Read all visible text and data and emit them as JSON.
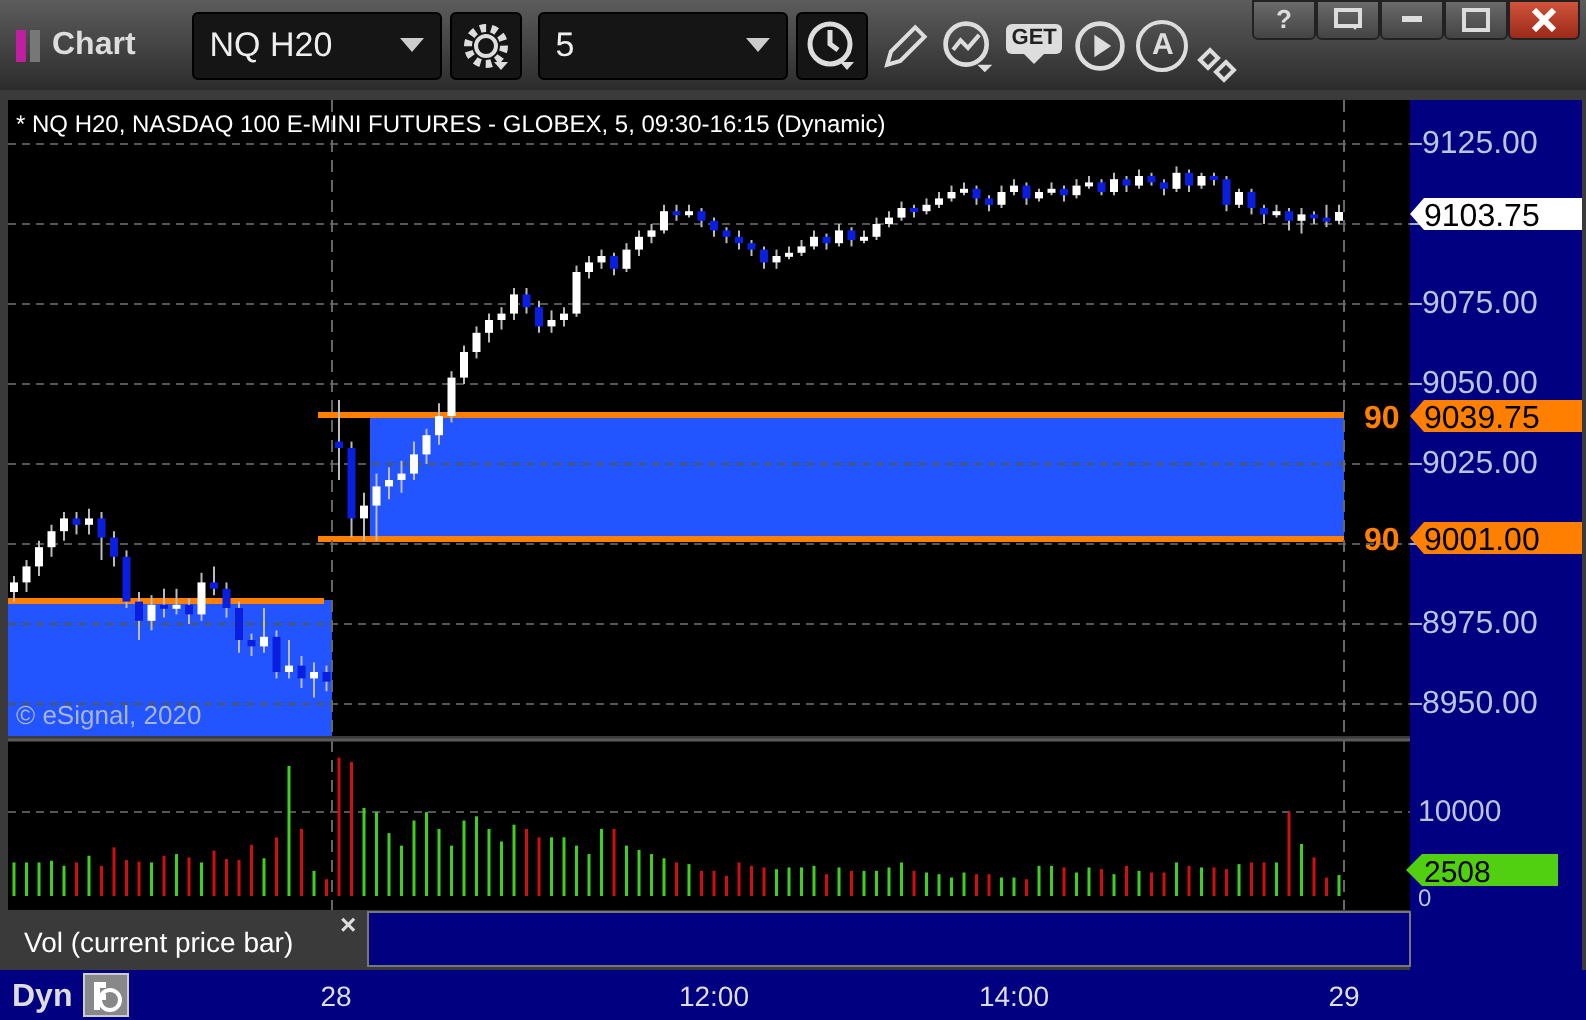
{
  "toolbar": {
    "app_title": "Chart",
    "symbol": "NQ H20",
    "interval": "5",
    "get_button": "GET",
    "letter_button": "A"
  },
  "window_buttons": {
    "help": "?"
  },
  "chart": {
    "title": "* NQ H20, NASDAQ 100 E-MINI FUTURES - GLOBEX, 5, 09:30-16:15 (Dynamic)",
    "copyright": "© eSignal, 2020",
    "price_tags": [
      {
        "text": "9103.75",
        "kind": "last"
      },
      {
        "text": "9039.75",
        "kind": "level"
      },
      {
        "text": "9001.00",
        "kind": "level"
      }
    ],
    "level_labels": [
      "90",
      "90"
    ],
    "chart_data": {
      "type": "candlestick",
      "ylim": [
        8940,
        9138.75
      ],
      "yticks": [
        {
          "value": 9125,
          "label": "9125.00"
        },
        {
          "value": 9075,
          "label": "9075.00"
        },
        {
          "value": 9050,
          "label": "9050.00"
        },
        {
          "value": 9025,
          "label": "9025.00"
        },
        {
          "value": 8975,
          "label": "8975.00"
        },
        {
          "value": 8950,
          "label": "8950.00"
        }
      ],
      "categories": [
        null,
        null,
        null,
        null,
        null,
        null,
        null,
        null,
        null,
        null,
        null,
        null,
        null,
        null,
        null,
        null,
        null,
        null,
        null,
        null,
        null,
        null,
        null,
        null,
        null,
        null,
        null,
        null,
        null,
        null,
        null,
        null,
        null,
        null,
        null,
        null,
        null,
        null,
        null,
        null,
        null,
        null,
        null,
        null,
        null,
        null,
        null,
        null,
        null,
        null,
        null,
        null,
        null,
        null,
        null,
        null,
        null,
        null,
        null,
        null,
        null,
        null,
        null,
        null,
        null,
        null,
        null,
        null,
        null,
        null,
        null,
        null,
        null,
        null,
        null,
        null,
        null,
        null,
        null,
        null,
        null,
        null,
        null,
        null,
        null,
        null,
        null,
        null,
        null,
        null,
        null,
        null,
        null,
        null,
        null,
        null,
        null,
        null,
        null,
        null,
        null,
        null,
        null,
        null,
        null,
        null,
        null
      ],
      "ohlc": [
        [
          8985,
          8990,
          8982,
          8988
        ],
        [
          8988,
          8995,
          8985,
          8993
        ],
        [
          8993,
          9001,
          8990,
          8999
        ],
        [
          8999,
          9006,
          8996,
          9004
        ],
        [
          9004,
          9010,
          9001,
          9008
        ],
        [
          9008,
          9010,
          9003,
          9006
        ],
        [
          9006,
          9011,
          9003,
          9008
        ],
        [
          9008,
          9010,
          8995,
          9002
        ],
        [
          9002,
          9004,
          8993,
          8996
        ],
        [
          8996,
          8998,
          8980,
          8982
        ],
        [
          8982,
          8985,
          8970,
          8976
        ],
        [
          8976,
          8984,
          8973,
          8981
        ],
        [
          8981,
          8986,
          8977,
          8980
        ],
        [
          8980,
          8986,
          8978,
          8981
        ],
        [
          8981,
          8983,
          8975,
          8978
        ],
        [
          8978,
          8991,
          8976,
          8988
        ],
        [
          8988,
          8993,
          8984,
          8986
        ],
        [
          8986,
          8988,
          8977,
          8980
        ],
        [
          8980,
          8982,
          8966,
          8970
        ],
        [
          8970,
          8972,
          8965,
          8968
        ],
        [
          8968,
          8980,
          8966,
          8971
        ],
        [
          8971,
          8973,
          8958,
          8960
        ],
        [
          8960,
          8970,
          8958,
          8962
        ],
        [
          8962,
          8965,
          8955,
          8958
        ],
        [
          8958,
          8963,
          8952,
          8960
        ],
        [
          8960,
          8962,
          8954,
          8957
        ],
        [
          9032,
          9045,
          9020,
          9030
        ],
        [
          9030,
          9032,
          9002,
          9008
        ],
        [
          9008,
          9016,
          9001,
          9012
        ],
        [
          9012,
          9022,
          9001,
          9018
        ],
        [
          9018,
          9024,
          9014,
          9020
        ],
        [
          9020,
          9026,
          9016,
          9022
        ],
        [
          9022,
          9032,
          9020,
          9028
        ],
        [
          9028,
          9036,
          9025,
          9034
        ],
        [
          9034,
          9044,
          9031,
          9040
        ],
        [
          9040,
          9054,
          9038,
          9052
        ],
        [
          9052,
          9062,
          9050,
          9060
        ],
        [
          9060,
          9068,
          9058,
          9066
        ],
        [
          9066,
          9072,
          9063,
          9070
        ],
        [
          9070,
          9074,
          9067,
          9072
        ],
        [
          9072,
          9080,
          9070,
          9078
        ],
        [
          9078,
          9080,
          9072,
          9074
        ],
        [
          9074,
          9076,
          9066,
          9068
        ],
        [
          9068,
          9073,
          9066,
          9070
        ],
        [
          9070,
          9074,
          9068,
          9072
        ],
        [
          9072,
          9087,
          9071,
          9085
        ],
        [
          9085,
          9090,
          9083,
          9088
        ],
        [
          9088,
          9092,
          9086,
          9090
        ],
        [
          9090,
          9091,
          9084,
          9086
        ],
        [
          9086,
          9094,
          9085,
          9092
        ],
        [
          9092,
          9098,
          9090,
          9096
        ],
        [
          9096,
          9100,
          9094,
          9098
        ],
        [
          9098,
          9106,
          9097,
          9104
        ],
        [
          9104,
          9106,
          9101,
          9103
        ],
        [
          9103,
          9106,
          9102,
          9104
        ],
        [
          9104,
          9105,
          9099,
          9101
        ],
        [
          9101,
          9102,
          9096,
          9098
        ],
        [
          9098,
          9099,
          9094,
          9096
        ],
        [
          9096,
          9098,
          9092,
          9094
        ],
        [
          9094,
          9095,
          9090,
          9092
        ],
        [
          9092,
          9093,
          9086,
          9088
        ],
        [
          9088,
          9092,
          9086,
          9090
        ],
        [
          9090,
          9093,
          9089,
          9091
        ],
        [
          9091,
          9095,
          9090,
          9093
        ],
        [
          9093,
          9098,
          9092,
          9096
        ],
        [
          9096,
          9097,
          9092,
          9094
        ],
        [
          9094,
          9100,
          9093,
          9098
        ],
        [
          9098,
          9099,
          9093,
          9095
        ],
        [
          9095,
          9098,
          9094,
          9096
        ],
        [
          9096,
          9102,
          9095,
          9100
        ],
        [
          9100,
          9104,
          9099,
          9102
        ],
        [
          9102,
          9107,
          9101,
          9105
        ],
        [
          9105,
          9106,
          9102,
          9104
        ],
        [
          9104,
          9108,
          9103,
          9106
        ],
        [
          9106,
          9110,
          9105,
          9108
        ],
        [
          9108,
          9112,
          9107,
          9110
        ],
        [
          9110,
          9113,
          9109,
          9111
        ],
        [
          9111,
          9112,
          9106,
          9108
        ],
        [
          9108,
          9109,
          9104,
          9106
        ],
        [
          9106,
          9112,
          9105,
          9110
        ],
        [
          9110,
          9114,
          9109,
          9112
        ],
        [
          9112,
          9113,
          9106,
          9108
        ],
        [
          9108,
          9111,
          9107,
          9110
        ],
        [
          9110,
          9113,
          9109,
          9111
        ],
        [
          9111,
          9112,
          9107,
          9109
        ],
        [
          9109,
          9114,
          9108,
          9112
        ],
        [
          9112,
          9115,
          9111,
          9113
        ],
        [
          9113,
          9114,
          9109,
          9110
        ],
        [
          9110,
          9116,
          9109,
          9114
        ],
        [
          9114,
          9115,
          9110,
          9112
        ],
        [
          9112,
          9117,
          9111,
          9115
        ],
        [
          9115,
          9116,
          9112,
          9113
        ],
        [
          9113,
          9114,
          9109,
          9111
        ],
        [
          9111,
          9118,
          9110,
          9116
        ],
        [
          9116,
          9117,
          9110,
          9112
        ],
        [
          9112,
          9116,
          9111,
          9115
        ],
        [
          9115,
          9116,
          9112,
          9114
        ],
        [
          9114,
          9115,
          9104,
          9106
        ],
        [
          9106,
          9111,
          9105,
          9110
        ],
        [
          9110,
          9111,
          9103,
          9105
        ],
        [
          9105,
          9106,
          9100,
          9103
        ],
        [
          9103,
          9106,
          9102,
          9104
        ],
        [
          9104,
          9105,
          9098,
          9101
        ],
        [
          9101,
          9105,
          9097,
          9103
        ],
        [
          9103,
          9104,
          9100,
          9102
        ],
        [
          9102,
          9106,
          9099,
          9101
        ],
        [
          9101,
          9106,
          9100,
          9103.75
        ]
      ]
    }
  },
  "volume": {
    "tag": "2508",
    "legend": "Vol (current price bar)",
    "close": "×",
    "chart_data": {
      "type": "bar",
      "ylim": [
        0,
        18600
      ],
      "yticks": [
        {
          "value": 10000,
          "label": "10000"
        },
        {
          "value": 0,
          "label": "0"
        }
      ],
      "categories": [
        null,
        null,
        null,
        null,
        null,
        null,
        null,
        null,
        null,
        null,
        null,
        null,
        null,
        null,
        null,
        null,
        null,
        null,
        null,
        null,
        null,
        null,
        null,
        null,
        null,
        null,
        null,
        null,
        null,
        null,
        null,
        null,
        null,
        null,
        null,
        null,
        null,
        null,
        null,
        null,
        null,
        null,
        null,
        null,
        null,
        null,
        null,
        null,
        null,
        null,
        null,
        null,
        null,
        null,
        null,
        null,
        null,
        null,
        null,
        null,
        null,
        null,
        null,
        null,
        null,
        null,
        null,
        null,
        null,
        null,
        null,
        null,
        null,
        null,
        null,
        null,
        null,
        null,
        null,
        null,
        null,
        null,
        null,
        null,
        null,
        null,
        null,
        null,
        null,
        null,
        null,
        null,
        null,
        null,
        null,
        null,
        null,
        null,
        null,
        null,
        null,
        null,
        null,
        null,
        null,
        null,
        null
      ],
      "values": [
        4000,
        4000,
        4000,
        4200,
        3600,
        4000,
        4800,
        3600,
        5800,
        4300,
        4100,
        4000,
        4800,
        5000,
        4600,
        4000,
        5400,
        4400,
        4300,
        6100,
        4500,
        7000,
        15500,
        8000,
        3000,
        2000,
        16500,
        16000,
        10500,
        10000,
        7500,
        6000,
        9000,
        10000,
        8000,
        6000,
        9000,
        9500,
        8000,
        6500,
        8500,
        8000,
        7000,
        7000,
        7000,
        6000,
        5000,
        8000,
        8000,
        6000,
        5500,
        5000,
        4500,
        4000,
        3800,
        3000,
        3000,
        2400,
        4000,
        3600,
        3400,
        3200,
        3400,
        3400,
        3600,
        2600,
        3400,
        3000,
        3000,
        3000,
        3400,
        4000,
        3000,
        2800,
        2600,
        2200,
        2800,
        2600,
        2600,
        2200,
        2200,
        2000,
        3600,
        3600,
        3400,
        2800,
        3400,
        3200,
        2600,
        3600,
        3000,
        2800,
        2800,
        4000,
        3600,
        3400,
        3400,
        3200,
        3800,
        4000,
        4000,
        4000,
        10000,
        6200,
        4600,
        2200,
        2500
      ]
    }
  },
  "time_axis": {
    "mode": "Dyn",
    "labels": [
      "28",
      "12:00",
      "14:00",
      "29"
    ]
  }
}
